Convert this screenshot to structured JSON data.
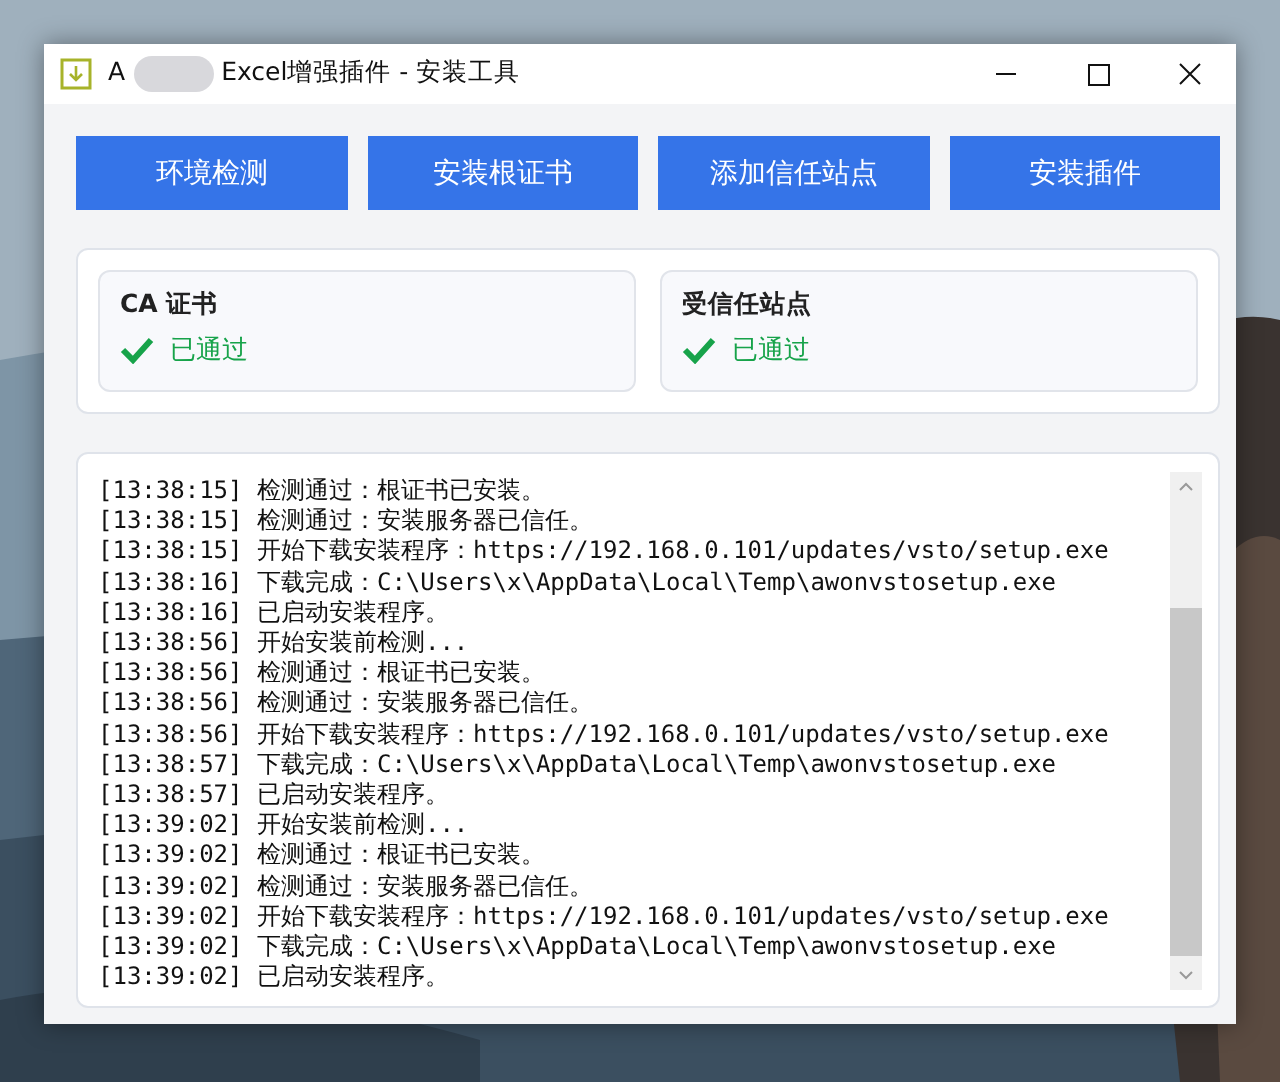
{
  "window": {
    "title": "A",
    "title_rest": "Excel增强插件 - 安装工具"
  },
  "buttons": [
    "环境检测",
    "安装根证书",
    "添加信任站点",
    "安装插件"
  ],
  "checks": [
    {
      "title": "CA 证书",
      "status": "已通过",
      "passed": true
    },
    {
      "title": "受信任站点",
      "status": "已通过",
      "passed": true
    }
  ],
  "log": {
    "lines": [
      "[13:38:15] 检测通过：根证书已安装。",
      "[13:38:15] 检测通过：安装服务器已信任。",
      "[13:38:15] 开始下载安装程序：https://192.168.0.101/updates/vsto/setup.exe",
      "[13:38:16] 下载完成：C:\\Users\\x\\AppData\\Local\\Temp\\awonvstosetup.exe",
      "[13:38:16] 已启动安装程序。",
      "[13:38:56] 开始安装前检测...",
      "[13:38:56] 检测通过：根证书已安装。",
      "[13:38:56] 检测通过：安装服务器已信任。",
      "[13:38:56] 开始下载安装程序：https://192.168.0.101/updates/vsto/setup.exe",
      "[13:38:57] 下载完成：C:\\Users\\x\\AppData\\Local\\Temp\\awonvstosetup.exe",
      "[13:38:57] 已启动安装程序。",
      "[13:39:02] 开始安装前检测...",
      "[13:39:02] 检测通过：根证书已安装。",
      "[13:39:02] 检测通过：安装服务器已信任。",
      "[13:39:02] 开始下载安装程序：https://192.168.0.101/updates/vsto/setup.exe",
      "[13:39:02] 下载完成：C:\\Users\\x\\AppData\\Local\\Temp\\awonvstosetup.exe",
      "[13:39:02] 已启动安装程序。"
    ]
  }
}
